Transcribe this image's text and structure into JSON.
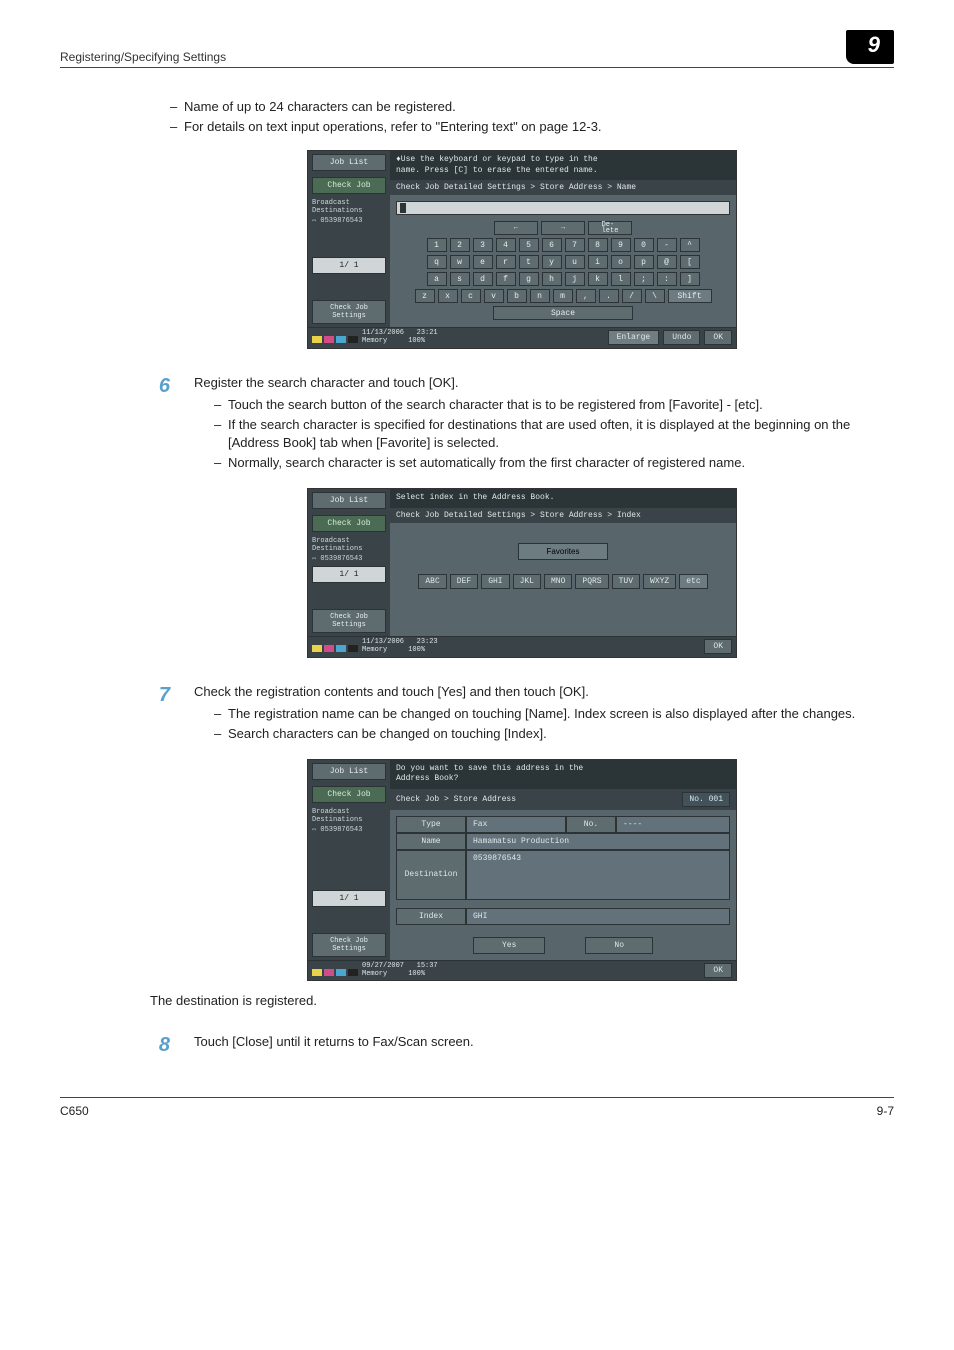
{
  "header": {
    "title": "Registering/Specifying Settings",
    "chapter": "9"
  },
  "intro_bullets": [
    "Name of up to 24 characters can be registered.",
    "For details on text input operations, refer to \"Entering text\" on page 12-3."
  ],
  "screen1": {
    "job_list": "Job List",
    "check_job": "Check Job",
    "broadcast": "Broadcast\nDestinations",
    "dest_num": "0539876543",
    "page": "1/  1",
    "check_settings": "Check Job\nSettings",
    "msg_top": "♦Use the keyboard or keypad to type in the\nname. Press [C] to erase the entered name.",
    "crumb": "Check Job Detailed Settings > Store Address > Name",
    "arrow_l": "←",
    "arrow_r": "→",
    "delete": "De-\nlete",
    "row1": [
      "1",
      "2",
      "3",
      "4",
      "5",
      "6",
      "7",
      "8",
      "9",
      "0",
      "-",
      "^"
    ],
    "row2": [
      "q",
      "w",
      "e",
      "r",
      "t",
      "y",
      "u",
      "i",
      "o",
      "p",
      "@",
      "["
    ],
    "row3": [
      "a",
      "s",
      "d",
      "f",
      "g",
      "h",
      "j",
      "k",
      "l",
      ";",
      ":",
      "]"
    ],
    "row4": [
      "z",
      "x",
      "c",
      "v",
      "b",
      "n",
      "m",
      ",",
      ".",
      "/",
      "\\"
    ],
    "shift": "Shift",
    "space": "Space",
    "date": "11/13/2006",
    "time": "23:21",
    "mem": "Memory",
    "pct": "100%",
    "enlarge": "Enlarge",
    "undo": "Undo",
    "ok": "OK"
  },
  "step6": {
    "num": "6",
    "text": "Register the search character and touch [OK].",
    "bullets": [
      "Touch the search button of the search character that is to be registered from [Favorite] - [etc].",
      "If the search character is specified for destinations that are used often, it is displayed at the beginning on the [Address Book] tab when [Favorite] is selected.",
      "Normally, search character is set automatically from the first character of registered name."
    ]
  },
  "screen2": {
    "msg_top": "Select index in the Address Book.",
    "crumb": "Check Job Detailed Settings > Store Address > Index",
    "favorites": "Favorites",
    "idx": [
      "ABC",
      "DEF",
      "GHI",
      "JKL",
      "MNO",
      "PQRS",
      "TUV",
      "WXYZ",
      "etc"
    ],
    "date": "11/13/2006",
    "time": "23:23"
  },
  "step7": {
    "num": "7",
    "text": "Check the registration contents and touch [Yes] and then touch [OK].",
    "bullets": [
      "The registration name can be changed on touching [Name]. Index screen is also displayed after the changes.",
      "Search characters can be changed on touching [Index]."
    ]
  },
  "screen3": {
    "msg_top": "Do you want to save this address in the\nAddress Book?",
    "crumb": "Check Job > Store Address",
    "no_badge": "No. 001",
    "type_l": "Type",
    "type_v": "Fax",
    "no_l": "No.",
    "no_v": "----",
    "name_l": "Name",
    "name_v": "Hamamatsu Production",
    "dest_l": "Destination",
    "dest_v": "0539876543",
    "index_l": "Index",
    "index_v": "GHI",
    "yes": "Yes",
    "no": "No",
    "date": "09/27/2007",
    "time": "15:37"
  },
  "after_screen3": "The destination is registered.",
  "step8": {
    "num": "8",
    "text": "Touch [Close] until it returns to Fax/Scan screen."
  },
  "footer": {
    "model": "C650",
    "page": "9-7"
  }
}
